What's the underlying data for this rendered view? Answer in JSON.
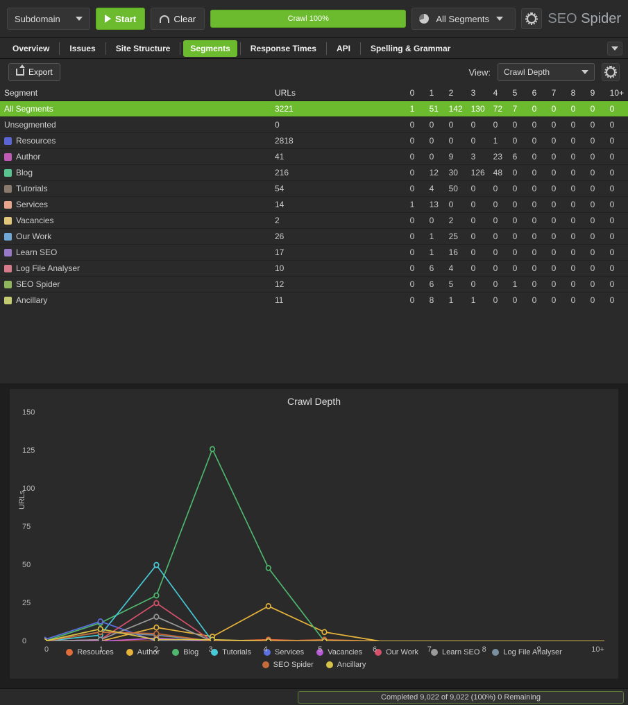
{
  "toolbar": {
    "subdomain_label": "Subdomain",
    "start_label": "Start",
    "clear_label": "Clear",
    "crawl_status": "Crawl 100%",
    "segments_label": "All Segments",
    "logo_seo": "SEO",
    "logo_spider": "Spider"
  },
  "tabs": {
    "items": [
      "Overview",
      "Issues",
      "Site Structure",
      "Segments",
      "Response Times",
      "API",
      "Spelling & Grammar"
    ],
    "active_index": 3
  },
  "subbar": {
    "export_label": "Export",
    "view_label": "View:",
    "view_value": "Crawl Depth"
  },
  "table": {
    "headers": [
      "Segment",
      "URLs",
      "0",
      "1",
      "2",
      "3",
      "4",
      "5",
      "6",
      "7",
      "8",
      "9",
      "10+"
    ],
    "rows": [
      {
        "label": "All Segments",
        "color": null,
        "highlight": true,
        "cells": [
          "3221",
          "1",
          "51",
          "142",
          "130",
          "72",
          "7",
          "0",
          "0",
          "0",
          "0",
          "0"
        ]
      },
      {
        "label": "Unsegmented",
        "color": null,
        "cells": [
          "0",
          "0",
          "0",
          "0",
          "0",
          "0",
          "0",
          "0",
          "0",
          "0",
          "0",
          "0"
        ]
      },
      {
        "label": "Resources",
        "color": "#5a66d6",
        "cells": [
          "2818",
          "0",
          "0",
          "0",
          "0",
          "1",
          "0",
          "0",
          "0",
          "0",
          "0",
          "0"
        ]
      },
      {
        "label": "Author",
        "color": "#c05ab4",
        "cells": [
          "41",
          "0",
          "0",
          "9",
          "3",
          "23",
          "6",
          "0",
          "0",
          "0",
          "0",
          "0"
        ]
      },
      {
        "label": "Blog",
        "color": "#59c490",
        "cells": [
          "216",
          "0",
          "12",
          "30",
          "126",
          "48",
          "0",
          "0",
          "0",
          "0",
          "0",
          "0"
        ]
      },
      {
        "label": "Tutorials",
        "color": "#8a7a6d",
        "cells": [
          "54",
          "0",
          "4",
          "50",
          "0",
          "0",
          "0",
          "0",
          "0",
          "0",
          "0",
          "0"
        ]
      },
      {
        "label": "Services",
        "color": "#e8a58c",
        "cells": [
          "14",
          "1",
          "13",
          "0",
          "0",
          "0",
          "0",
          "0",
          "0",
          "0",
          "0",
          "0"
        ]
      },
      {
        "label": "Vacancies",
        "color": "#e2c77a",
        "cells": [
          "2",
          "0",
          "0",
          "2",
          "0",
          "0",
          "0",
          "0",
          "0",
          "0",
          "0",
          "0"
        ]
      },
      {
        "label": "Our Work",
        "color": "#6fa7d6",
        "cells": [
          "26",
          "0",
          "1",
          "25",
          "0",
          "0",
          "0",
          "0",
          "0",
          "0",
          "0",
          "0"
        ]
      },
      {
        "label": "Learn SEO",
        "color": "#9a78c8",
        "cells": [
          "17",
          "0",
          "1",
          "16",
          "0",
          "0",
          "0",
          "0",
          "0",
          "0",
          "0",
          "0"
        ]
      },
      {
        "label": "Log File Analyser",
        "color": "#d77a8c",
        "cells": [
          "10",
          "0",
          "6",
          "4",
          "0",
          "0",
          "0",
          "0",
          "0",
          "0",
          "0",
          "0"
        ]
      },
      {
        "label": "SEO Spider",
        "color": "#8fb65a",
        "cells": [
          "12",
          "0",
          "6",
          "5",
          "0",
          "0",
          "1",
          "0",
          "0",
          "0",
          "0",
          "0"
        ]
      },
      {
        "label": "Ancillary",
        "color": "#c5cc6f",
        "cells": [
          "11",
          "0",
          "8",
          "1",
          "1",
          "0",
          "0",
          "0",
          "0",
          "0",
          "0",
          "0"
        ]
      }
    ]
  },
  "chart": {
    "title": "Crawl Depth",
    "ylabel": "URLs",
    "yticks": [
      0,
      25,
      50,
      75,
      100,
      125,
      150
    ],
    "xticks": [
      "0",
      "1",
      "2",
      "3",
      "4",
      "5",
      "6",
      "7",
      "8",
      "9",
      "10+"
    ],
    "legend": [
      {
        "name": "Resources",
        "color": "#e26d3a"
      },
      {
        "name": "Author",
        "color": "#e6b33a"
      },
      {
        "name": "Blog",
        "color": "#4fb86f"
      },
      {
        "name": "Tutorials",
        "color": "#48c9d8"
      },
      {
        "name": "Services",
        "color": "#5b6fe0"
      },
      {
        "name": "Vacancies",
        "color": "#b95ad6"
      },
      {
        "name": "Our Work",
        "color": "#d6506a"
      },
      {
        "name": "Learn SEO",
        "color": "#9a9a9a"
      },
      {
        "name": "Log File Analyser",
        "color": "#7b8fa0"
      },
      {
        "name": "SEO Spider",
        "color": "#c56a3a"
      },
      {
        "name": "Ancillary",
        "color": "#d6c24a"
      }
    ]
  },
  "chart_data": {
    "type": "line",
    "title": "Crawl Depth",
    "xlabel": "",
    "ylabel": "URLs",
    "x": [
      0,
      1,
      2,
      3,
      4,
      5,
      6,
      7,
      8,
      9,
      10
    ],
    "ylim": [
      0,
      150
    ],
    "categories": [
      "0",
      "1",
      "2",
      "3",
      "4",
      "5",
      "6",
      "7",
      "8",
      "9",
      "10+"
    ],
    "series": [
      {
        "name": "Resources",
        "color": "#e26d3a",
        "values": [
          0,
          0,
          0,
          0,
          1,
          0,
          0,
          0,
          0,
          0,
          0
        ]
      },
      {
        "name": "Author",
        "color": "#e6b33a",
        "values": [
          0,
          0,
          9,
          3,
          23,
          6,
          0,
          0,
          0,
          0,
          0
        ]
      },
      {
        "name": "Blog",
        "color": "#4fb86f",
        "values": [
          0,
          12,
          30,
          126,
          48,
          0,
          0,
          0,
          0,
          0,
          0
        ]
      },
      {
        "name": "Tutorials",
        "color": "#48c9d8",
        "values": [
          0,
          4,
          50,
          0,
          0,
          0,
          0,
          0,
          0,
          0,
          0
        ]
      },
      {
        "name": "Services",
        "color": "#5b6fe0",
        "values": [
          1,
          13,
          0,
          0,
          0,
          0,
          0,
          0,
          0,
          0,
          0
        ]
      },
      {
        "name": "Vacancies",
        "color": "#b95ad6",
        "values": [
          0,
          0,
          2,
          0,
          0,
          0,
          0,
          0,
          0,
          0,
          0
        ]
      },
      {
        "name": "Our Work",
        "color": "#d6506a",
        "values": [
          0,
          1,
          25,
          0,
          0,
          0,
          0,
          0,
          0,
          0,
          0
        ]
      },
      {
        "name": "Learn SEO",
        "color": "#9a9a9a",
        "values": [
          0,
          1,
          16,
          0,
          0,
          0,
          0,
          0,
          0,
          0,
          0
        ]
      },
      {
        "name": "Log File Analyser",
        "color": "#7b8fa0",
        "values": [
          0,
          6,
          4,
          0,
          0,
          0,
          0,
          0,
          0,
          0,
          0
        ]
      },
      {
        "name": "SEO Spider",
        "color": "#c56a3a",
        "values": [
          0,
          6,
          5,
          0,
          0,
          1,
          0,
          0,
          0,
          0,
          0
        ]
      },
      {
        "name": "Ancillary",
        "color": "#d6c24a",
        "values": [
          0,
          8,
          1,
          1,
          0,
          0,
          0,
          0,
          0,
          0,
          0
        ]
      }
    ]
  },
  "status": {
    "text": "Completed 9,022 of 9,022 (100%) 0 Remaining"
  }
}
